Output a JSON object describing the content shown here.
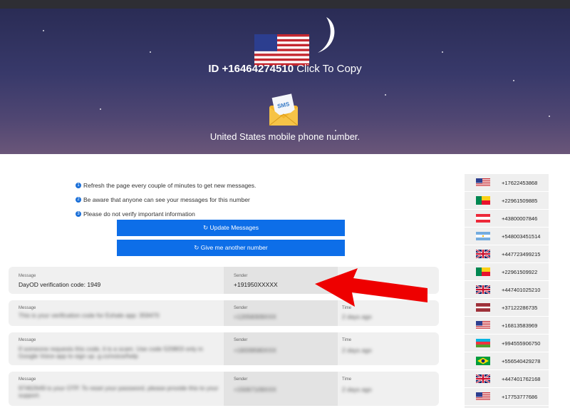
{
  "hero": {
    "id_prefix": "ID +16464274510",
    "copy_label": " Click To Copy",
    "subtitle": "United States mobile phone number.",
    "envelope_label": "SMS"
  },
  "notes": {
    "items": [
      {
        "num": "1",
        "text": "Refresh the page every couple of minutes to get new messages."
      },
      {
        "num": "2",
        "text": "Be aware that anyone can see your messages for this number"
      },
      {
        "num": "3",
        "text": "Please do not verify important information"
      }
    ]
  },
  "buttons": {
    "update": "↻ Update Messages",
    "another": "↻ Give me another number"
  },
  "messages": {
    "label_message": "Message",
    "label_sender": "Sender",
    "label_time": "Time",
    "items": [
      {
        "text": "DayOD verification code: 1949",
        "sender": "+191950XXXXX",
        "time": ""
      },
      {
        "text": "This is your verification code for Exhale app: 359470",
        "sender": "+12058309XXX",
        "time": "2 days ago"
      },
      {
        "text": "If someone requests this code, it is a scam. Use code 520803 only in Google Voice app to sign up. g.co/voice/help",
        "sender": "+18339580XXX",
        "time": "2 days ago"
      },
      {
        "text": "97462649 is your OTP. To reset your password, please provide this to your support.",
        "sender": "+15067109XXX",
        "time": "2 days ago"
      }
    ]
  },
  "sidebar": {
    "items": [
      {
        "flag": "us",
        "phone": "+17622453868"
      },
      {
        "flag": "bj",
        "phone": "+22961509885"
      },
      {
        "flag": "at",
        "phone": "+43800007846"
      },
      {
        "flag": "ar",
        "phone": "+548003451514"
      },
      {
        "flag": "uk",
        "phone": "+447723499215"
      },
      {
        "flag": "bj",
        "phone": "+22961509922"
      },
      {
        "flag": "uk",
        "phone": "+447401025210"
      },
      {
        "flag": "lv",
        "phone": "+37122286735"
      },
      {
        "flag": "us",
        "phone": "+16813583969"
      },
      {
        "flag": "az",
        "phone": "+994555906750"
      },
      {
        "flag": "br",
        "phone": "+556540429278"
      },
      {
        "flag": "uk",
        "phone": "+447401762168"
      },
      {
        "flag": "us",
        "phone": "+17753777686"
      }
    ]
  },
  "colors": {
    "accent_button": "#0d6ee8",
    "arrow": "#ee0000"
  }
}
